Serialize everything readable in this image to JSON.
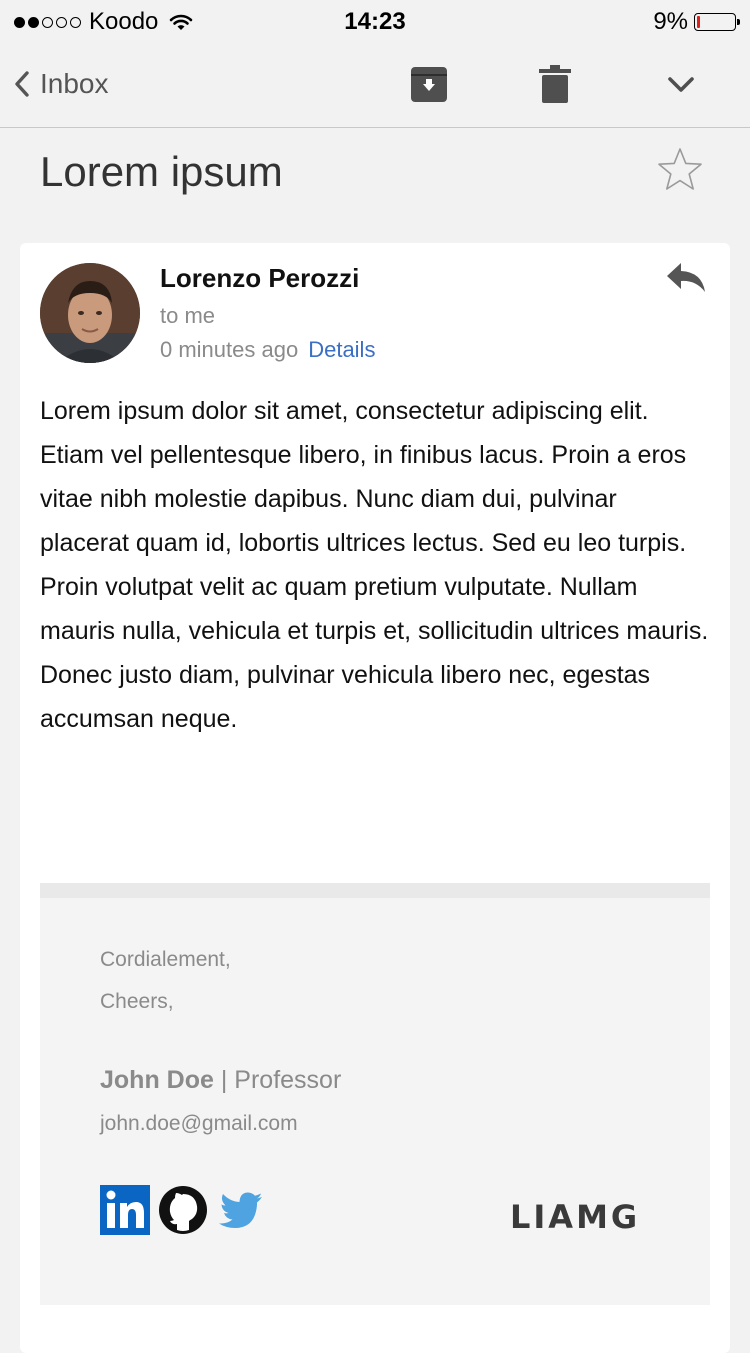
{
  "status_bar": {
    "carrier": "Koodo",
    "signal_dots_filled": 2,
    "signal_dots_total": 5,
    "time": "14:23",
    "battery_percent": "9%",
    "battery_level": 0.09
  },
  "nav": {
    "back_label": "Inbox",
    "icons": [
      "archive-icon",
      "trash-icon",
      "chevron-down-icon"
    ]
  },
  "email": {
    "subject": "Lorem ipsum",
    "sender_name": "Lorenzo Perozzi",
    "recipient": "to me",
    "time_ago": "0 minutes ago",
    "details_label": "Details",
    "body": "Lorem ipsum dolor sit amet, consectetur adipiscing elit. Etiam vel pellentesque libero, in finibus lacus. Proin a eros vitae nibh molestie dapibus. Nunc diam dui, pulvinar placerat quam id, lobortis ultrices lectus. Sed eu leo turpis. Proin volutpat velit ac quam pretium vulputate. Nullam mauris nulla, vehicula et turpis et, sollicitudin ultrices mauris. Donec justo diam, pulvinar vehicula libero nec, egestas accumsan neque."
  },
  "signature": {
    "closing_1": "Cordialement,",
    "closing_2": "Cheers,",
    "name": "John Doe",
    "separator": " | ",
    "title": "Professor",
    "email": "john.doe@gmail.com",
    "social": [
      "linkedin-icon",
      "github-icon",
      "twitter-icon"
    ],
    "logo": "LIAMG"
  },
  "colors": {
    "link": "#3b6fc4",
    "linkedin": "#0a66c2",
    "twitter": "#4ea3e0",
    "battery_low": "#e0201b"
  }
}
